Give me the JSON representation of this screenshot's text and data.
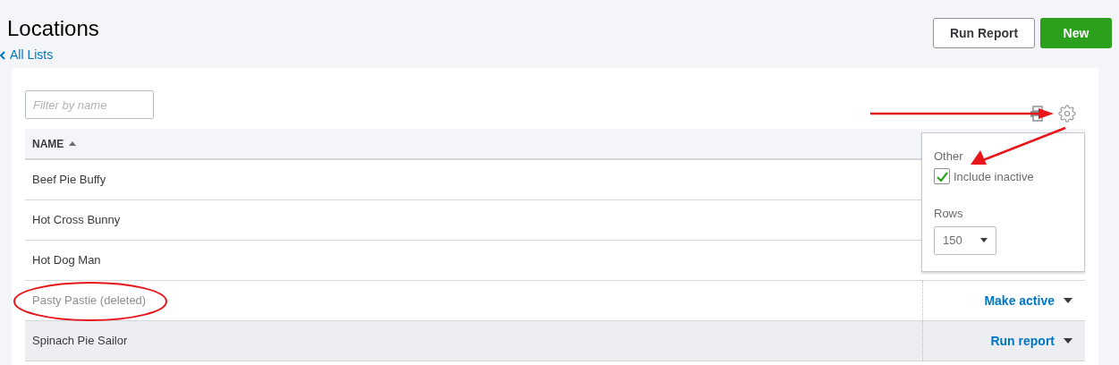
{
  "page": {
    "title": "Locations",
    "back_link": "All Lists"
  },
  "buttons": [
    {
      "label": "Run Report",
      "kind": "secondary"
    },
    {
      "label": "New",
      "kind": "primary"
    }
  ],
  "filter": {
    "placeholder": "Filter by name"
  },
  "table": {
    "columns": [
      {
        "label": "NAME",
        "sorted": true
      }
    ],
    "rows": [
      {
        "name": "Beef Pie Buffy",
        "deleted": false,
        "highlighted": false
      },
      {
        "name": "Hot Cross Bunny",
        "deleted": false,
        "highlighted": false
      },
      {
        "name": "Hot Dog Man",
        "deleted": false,
        "highlighted": false
      },
      {
        "name": "Pasty Pastie (deleted)",
        "deleted": true,
        "highlighted": false,
        "action": "Make active"
      },
      {
        "name": "Spinach Pie Sailor",
        "deleted": false,
        "highlighted": true,
        "action": "Run report"
      }
    ]
  },
  "settings_popover": {
    "section": "Other",
    "include_inactive": {
      "label": "Include inactive",
      "checked": true
    },
    "rows_label": "Rows",
    "rows_value": "150"
  }
}
